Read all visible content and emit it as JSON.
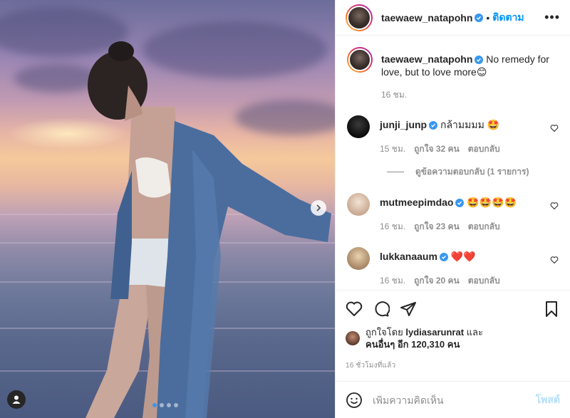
{
  "header": {
    "username": "taewaew_natapohn",
    "separator": "•",
    "follow_label": "ติดตาม",
    "more_label": "•••"
  },
  "caption": {
    "username": "taewaew_natapohn",
    "text": "No remedy for love, but to love more😊",
    "time": "16 ชม."
  },
  "comments": [
    {
      "username": "junji_junp",
      "text": "กล้ามมมม 🤩",
      "time": "15 ชม.",
      "likes": "ถูกใจ 32 คน",
      "reply": "ตอบกลับ",
      "view_replies": "ดูข้อความตอบกลับ (1 รายการ)"
    },
    {
      "username": "mutmeepimdao",
      "text": "🤩🤩🤩🤩",
      "time": "16 ชม.",
      "likes": "ถูกใจ 23 คน",
      "reply": "ตอบกลับ"
    },
    {
      "username": "lukkanaaum",
      "text": "❤️❤️",
      "time": "16 ชม.",
      "likes": "ถูกใจ 20 คน",
      "reply": "ตอบกลับ"
    }
  ],
  "likes": {
    "line1_prefix": "ถูกใจโดย",
    "liker": "lydiasarunrat",
    "line1_suffix": "และ",
    "line2": "คนอื่นๆ อีก 120,310 คน"
  },
  "timestamp": "16 ชั่วโมงที่แล้ว",
  "add_comment": {
    "placeholder": "เพิ่มความคิดเห็น",
    "post_label": "โพสต์"
  },
  "carousel": {
    "count": 4,
    "active": 1
  },
  "icons": [
    "heart-icon",
    "comment-icon",
    "share-icon",
    "bookmark-icon",
    "emoji-icon",
    "chevron-right-icon",
    "user-tag-icon",
    "verified-badge-icon"
  ],
  "colors": {
    "accent": "#0095f6",
    "verified": "#3897f0",
    "muted": "#8e8e8e"
  }
}
